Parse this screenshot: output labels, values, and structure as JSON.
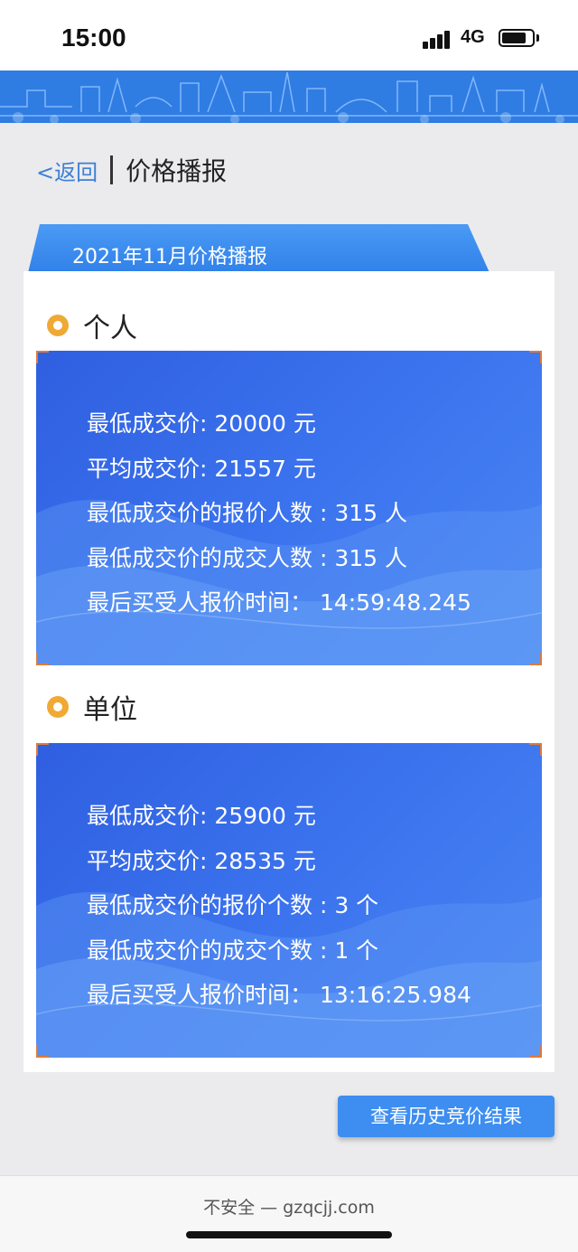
{
  "status_bar": {
    "time": "15:00",
    "network": "4G"
  },
  "nav": {
    "back_label": "<返回",
    "title": "价格播报"
  },
  "report": {
    "month_label": "2021年11月价格播报"
  },
  "sections": [
    {
      "title": "个人",
      "lines": [
        "最低成交价: 20000 元",
        "平均成交价:  21557 元",
        "最低成交价的报价人数 : 315 人",
        "最低成交价的成交人数 : 315 人",
        "最后买受人报价时间：  14:59:48.245"
      ]
    },
    {
      "title": "单位",
      "lines": [
        "最低成交价: 25900 元",
        "平均成交价:  28535 元",
        "最低成交价的报价个数 : 3 个",
        "最低成交价的成交个数 : 1 个",
        "最后买受人报价时间：  13:16:25.984"
      ]
    }
  ],
  "actions": {
    "history_label": "查看历史竞价结果"
  },
  "browser": {
    "url_text": "不安全 — gzqcjj.com"
  },
  "colors": {
    "accent": "#3d8ef0",
    "panel": "#3b73ee",
    "bullet": "#f0a935",
    "back_link": "#3d7fd6"
  }
}
